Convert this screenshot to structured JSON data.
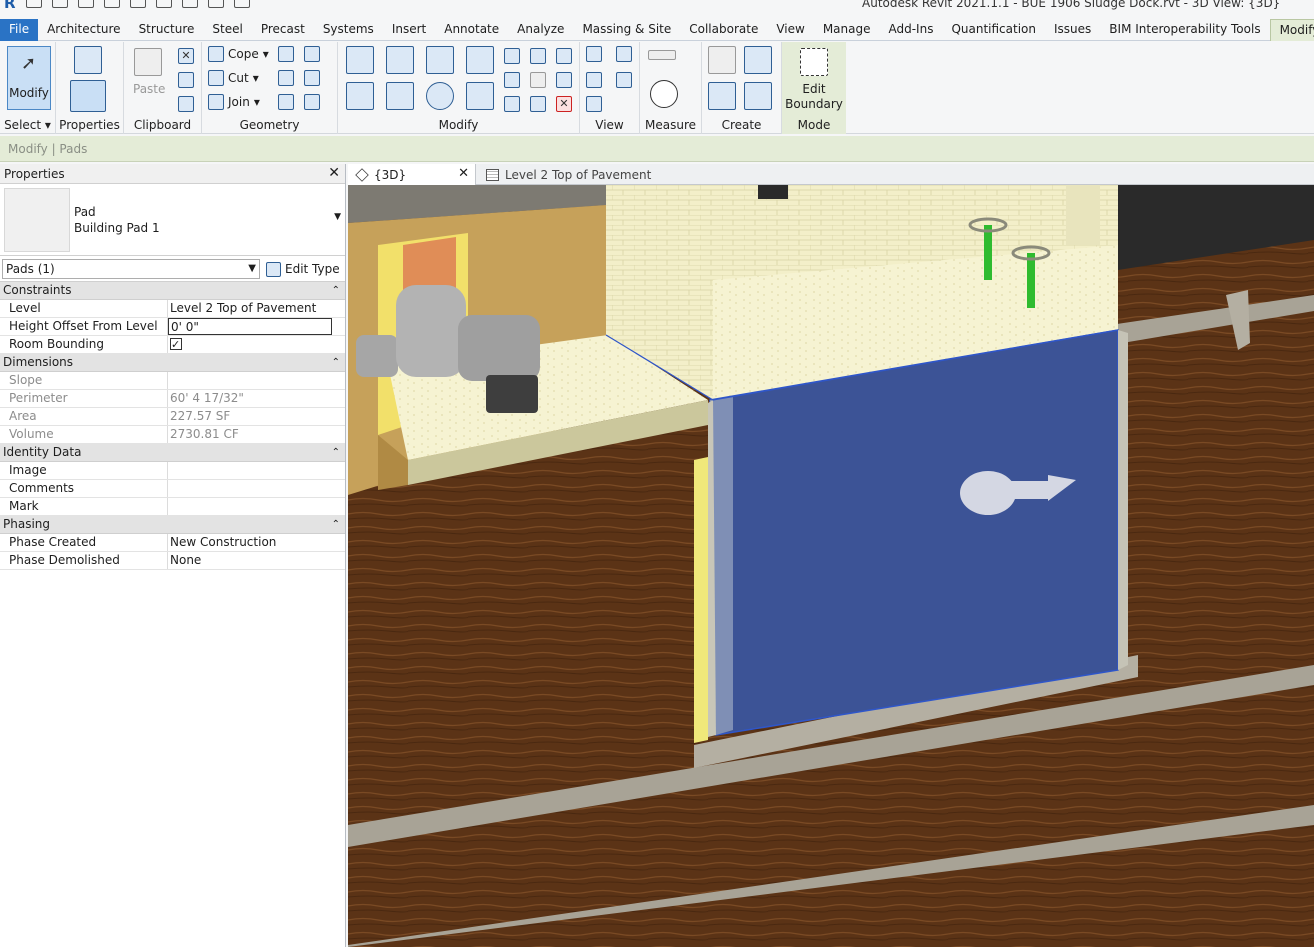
{
  "app": {
    "title": "Autodesk Revit 2021.1.1 - BUE 1906 Sludge Dock.rvt - 3D View: {3D}"
  },
  "ribbon_tabs": [
    "File",
    "Architecture",
    "Structure",
    "Steel",
    "Precast",
    "Systems",
    "Insert",
    "Annotate",
    "Analyze",
    "Massing & Site",
    "Collaborate",
    "View",
    "Manage",
    "Add-Ins",
    "Quantification",
    "Issues",
    "BIM Interoperability Tools",
    "Modify | Pads"
  ],
  "active_tab": "Modify | Pads",
  "ribbon": {
    "select": {
      "modify_label": "Modify",
      "panel_label": "Select"
    },
    "properties": {
      "panel_label": "Properties"
    },
    "clipboard": {
      "paste_label": "Paste",
      "panel_label": "Clipboard"
    },
    "geometry": {
      "cope_label": "Cope",
      "cut_label": "Cut",
      "join_label": "Join",
      "panel_label": "Geometry"
    },
    "modify": {
      "panel_label": "Modify"
    },
    "view": {
      "panel_label": "View"
    },
    "measure": {
      "panel_label": "Measure"
    },
    "create": {
      "panel_label": "Create"
    },
    "mode": {
      "edit_boundary_line1": "Edit",
      "edit_boundary_line2": "Boundary",
      "panel_label": "Mode"
    }
  },
  "options_bar": {
    "context": "Modify | Pads"
  },
  "properties": {
    "title": "Properties",
    "type_family": "Pad",
    "type_name": "Building Pad 1",
    "filter": "Pads (1)",
    "edit_type_label": "Edit Type",
    "categories": [
      {
        "name": "Constraints",
        "rows": [
          {
            "key": "Level",
            "value": "Level 2 Top of Pavement"
          },
          {
            "key": "Height Offset From Level",
            "value": "0'  0\""
          },
          {
            "key": "Room Bounding",
            "value": "checked"
          }
        ]
      },
      {
        "name": "Dimensions",
        "rows": [
          {
            "key": "Slope",
            "value": ""
          },
          {
            "key": "Perimeter",
            "value": "60'  4 17/32\""
          },
          {
            "key": "Area",
            "value": "227.57 SF"
          },
          {
            "key": "Volume",
            "value": "2730.81 CF"
          }
        ]
      },
      {
        "name": "Identity Data",
        "rows": [
          {
            "key": "Image",
            "value": ""
          },
          {
            "key": "Comments",
            "value": ""
          },
          {
            "key": "Mark",
            "value": ""
          }
        ]
      },
      {
        "name": "Phasing",
        "rows": [
          {
            "key": "Phase Created",
            "value": "New Construction"
          },
          {
            "key": "Phase Demolished",
            "value": "None"
          }
        ]
      }
    ]
  },
  "view_tabs": [
    {
      "label": "{3D}",
      "active": true
    },
    {
      "label": "Level 2 Top of Pavement",
      "active": false
    }
  ],
  "colors": {
    "accent": "#2a73c5",
    "context_tab": "#e4ecd7",
    "soil": "#5b3316",
    "pad_fill": "#3c5396"
  }
}
